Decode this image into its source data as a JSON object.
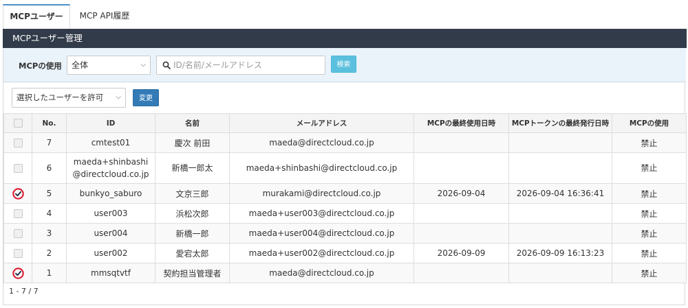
{
  "tabs": [
    {
      "label": "MCPユーザー"
    },
    {
      "label": "MCP API履歴"
    }
  ],
  "panel": {
    "title": "MCPユーザー管理"
  },
  "filter": {
    "label": "MCPの使用",
    "select_value": "全体",
    "search_placeholder": "ID/名前/メールアドレス",
    "search_button": "検索"
  },
  "bulk": {
    "select_value": "選択したユーザーを許可",
    "change_button": "変更"
  },
  "table": {
    "headers": [
      "No.",
      "ID",
      "名前",
      "メールアドレス",
      "MCPの最終使用日時",
      "MCPトークンの最終発行日時",
      "MCPの使用"
    ],
    "rows": [
      {
        "checked": false,
        "no": "7",
        "id": "cmtest01",
        "name": "慶次 前田",
        "email": "maeda@directcloud.co.jp",
        "last_used": "",
        "last_token": "",
        "usage": "禁止"
      },
      {
        "checked": false,
        "no": "6",
        "id": "maeda+shinbashi@directcloud.co.jp",
        "name": "新橋一郎太",
        "email": "maeda+shinbashi@directcloud.co.jp",
        "last_used": "",
        "last_token": "",
        "usage": "禁止"
      },
      {
        "checked": true,
        "no": "5",
        "id": "bunkyo_saburo",
        "name": "文京三郎",
        "email": "murakami@directcloud.co.jp",
        "last_used": "2026-09-04",
        "last_token": "2026-09-04 16:36:41",
        "usage": "禁止"
      },
      {
        "checked": false,
        "no": "4",
        "id": "user003",
        "name": "浜松次郎",
        "email": "maeda+user003@directcloud.co.jp",
        "last_used": "",
        "last_token": "",
        "usage": "禁止"
      },
      {
        "checked": false,
        "no": "3",
        "id": "user004",
        "name": "新橋一郎",
        "email": "maeda+user004@directcloud.co.jp",
        "last_used": "",
        "last_token": "",
        "usage": "禁止"
      },
      {
        "checked": false,
        "no": "2",
        "id": "user002",
        "name": "愛宕太郎",
        "email": "maeda+user002@directcloud.co.jp",
        "last_used": "2026-09-09",
        "last_token": "2026-09-09 16:13:23",
        "usage": "禁止"
      },
      {
        "checked": true,
        "no": "1",
        "id": "mmsqtvtf",
        "name": "契約担当管理者",
        "email": "maeda@directcloud.co.jp",
        "last_used": "",
        "last_token": "",
        "usage": "禁止"
      }
    ]
  },
  "pager": {
    "text": "1 - 7 / 7"
  },
  "colors": {
    "header_dark": "#323b4a",
    "tab_accent": "#4a90c8",
    "search_button": "#5bc0de",
    "change_button": "#337ab7",
    "check_mark": "#d9182d"
  },
  "icons": {
    "search": "search-icon",
    "chevron": "chevron-down-icon",
    "checked": "check-circle-icon"
  }
}
